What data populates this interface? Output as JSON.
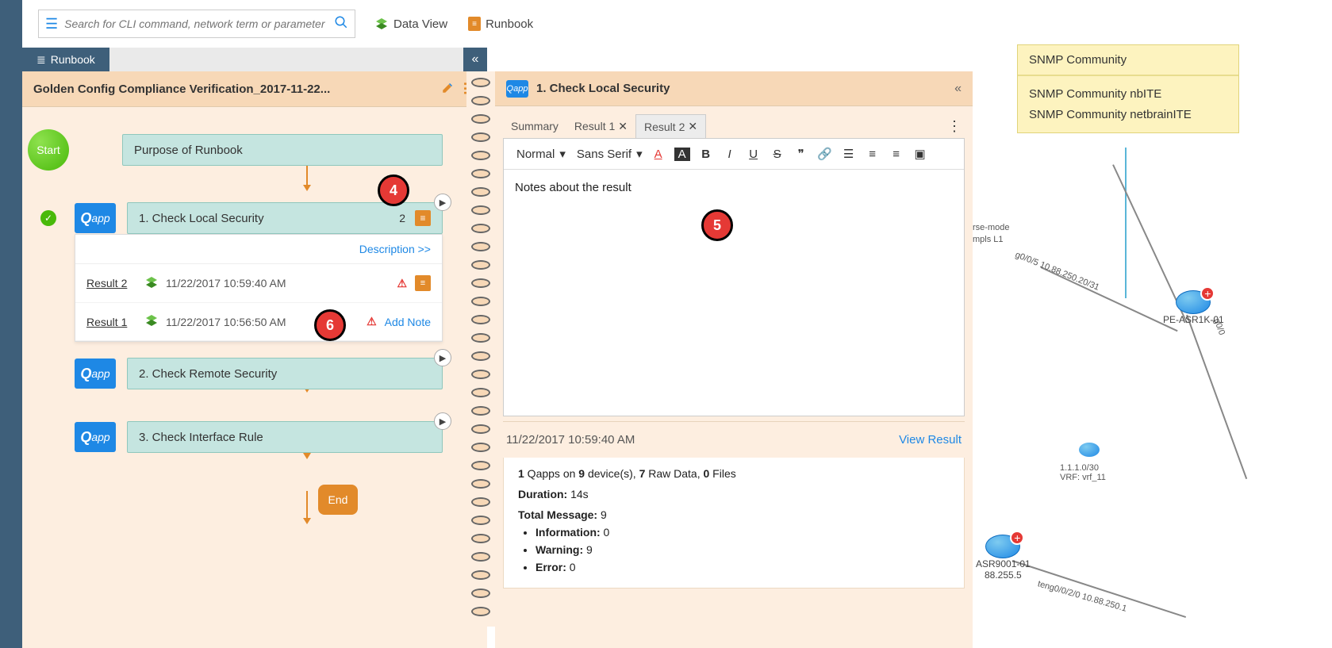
{
  "search": {
    "placeholder": "Search for CLI command, network term or parameter"
  },
  "toplinks": {
    "dataview": "Data View",
    "runbook": "Runbook"
  },
  "runbook_tab": "Runbook",
  "runbook_title": "Golden Config Compliance Verification_2017-11-22...",
  "flow": {
    "start": "Start",
    "purpose": "Purpose of Runbook",
    "step1": "1. Check Local Security",
    "step1_count": "2",
    "desc_link": "Description >>",
    "result2": {
      "name": "Result 2",
      "ts": "11/22/2017 10:59:40 AM"
    },
    "result1": {
      "name": "Result 1",
      "ts": "11/22/2017 10:56:50 AM",
      "addnote": "Add Note"
    },
    "step2": "2. Check Remote Security",
    "step3": "3. Check Interface Rule",
    "end": "End"
  },
  "detail": {
    "title": "1. Check Local Security",
    "tabs": {
      "summary": "Summary",
      "r1": "Result 1",
      "r2": "Result 2"
    },
    "toolbar": {
      "normal": "Normal",
      "font": "Sans Serif"
    },
    "note": "Notes about the result",
    "result_ts": "11/22/2017 10:59:40 AM",
    "view_result": "View Result",
    "stats_line": {
      "qapps": "1",
      "devices": "9",
      "raw": "7",
      "files": "0",
      "t1": " Qapps on ",
      "t2": " device(s), ",
      "t3": " Raw Data, ",
      "t4": " Files"
    },
    "duration_label": "Duration:",
    "duration_val": " 14s",
    "totalmsg_label": "Total Message:",
    "totalmsg_val": " 9",
    "info_label": "Information:",
    "info_val": " 0",
    "warn_label": "Warning:",
    "warn_val": " 9",
    "err_label": "Error:",
    "err_val": " 0"
  },
  "map": {
    "snmp_title": "SNMP Community",
    "snmp_l1": "SNMP Community nbITE",
    "snmp_l2": "SNMP Community netbrainITE",
    "dev1": "PE-ASR1K-01",
    "dev2": "ASR9001-01",
    "sub1": "88.255.5",
    "link_a": "g0/0/5 10.88.250.20/31",
    "link_b": "1.1.1.0/30",
    "link_c": "VRF: vrf_11",
    "link_d": "teng0/0/2/0 10.88.250.1",
    "link_e": "rse-mode",
    "link_f": "mpls L1",
    "link_g": "g0/0"
  },
  "callouts": {
    "c4": "4",
    "c5": "5",
    "c6": "6"
  }
}
